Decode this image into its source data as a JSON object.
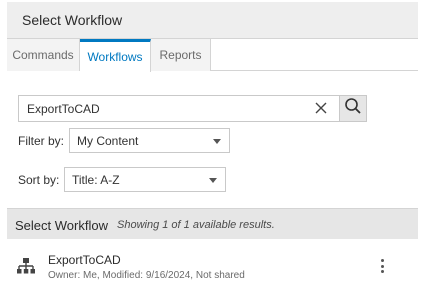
{
  "header": {
    "title": "Select Workflow"
  },
  "tabs": [
    {
      "label": "Commands",
      "active": false
    },
    {
      "label": "Workflows",
      "active": true
    },
    {
      "label": "Reports",
      "active": false
    }
  ],
  "search": {
    "value": "ExportToCAD",
    "clear_icon": "close-icon",
    "search_icon": "search-icon"
  },
  "filter": {
    "label": "Filter by:",
    "selected": "My Content"
  },
  "sort": {
    "label": "Sort by:",
    "selected": "Title: A-Z"
  },
  "results": {
    "title": "Select Workflow",
    "count_text": "Showing 1 of 1 available results."
  },
  "items": [
    {
      "title": "ExportToCAD",
      "meta": "Owner: Me, Modified: 9/16/2024, Not shared",
      "icon": "workflow-icon"
    }
  ],
  "colors": {
    "accent": "#0079c1",
    "header_bg": "#eeeeee",
    "results_bg": "#e6e6e6"
  }
}
